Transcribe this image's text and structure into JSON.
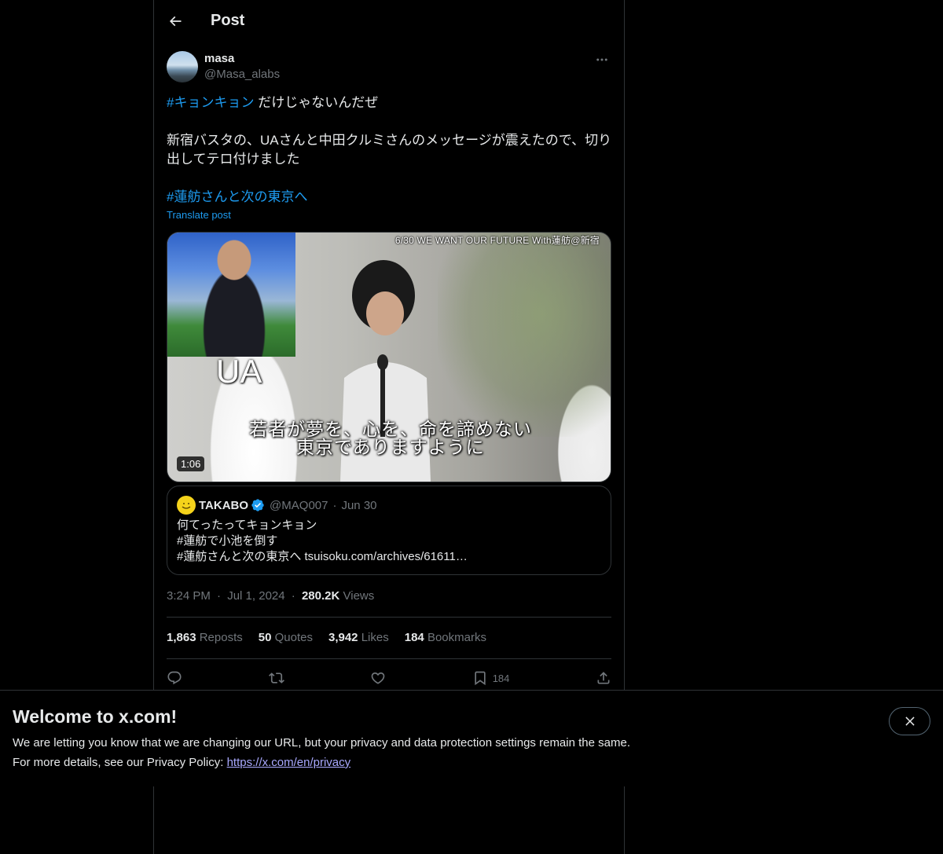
{
  "header": {
    "title": "Post"
  },
  "author": {
    "name": "masa",
    "handle": "@Masa_alabs"
  },
  "post": {
    "line1_hashtag": "#キョンキョン",
    "line1_rest": " だけじゃないんだぜ",
    "paragraph2": "新宿バスタの、UAさんと中田クルミさんのメッセージが震えたので、切り出してテロ付けました",
    "hashtag2": "#蓮舫さんと次の東京へ",
    "translate_label": "Translate post"
  },
  "media": {
    "top_caption": "6/30 WE WANT OUR FUTURE With蓮舫@新宿",
    "name_caption": "UA",
    "subtitle_line1": "若者が夢を、心を、命を諦めない",
    "subtitle_line2": "東京でありますように",
    "duration": "1:06"
  },
  "quote": {
    "name": "TAKABO",
    "handle": "@MAQ007",
    "dot": "·",
    "date": "Jun 30",
    "text": "何てったってキョンキョン\n#蓮舫で小池を倒す\n#蓮舫さんと次の東京へ tsuisoku.com/archives/61611…"
  },
  "meta": {
    "time": "3:24 PM",
    "dot1": "·",
    "date": "Jul 1, 2024",
    "dot2": "·",
    "views_count": "280.2K",
    "views_label": "Views"
  },
  "stats": {
    "reposts_count": "1,863",
    "reposts_label": "Reposts",
    "quotes_count": "50",
    "quotes_label": "Quotes",
    "likes_count": "3,942",
    "likes_label": "Likes",
    "bookmarks_count": "184",
    "bookmarks_label": "Bookmarks"
  },
  "actions": {
    "bookmark_count": "184"
  },
  "banner": {
    "title": "Welcome to x.com!",
    "line1": "We are letting you know that we are changing our URL, but your privacy and data protection settings remain the same.",
    "line2_prefix": "For more details, see our Privacy Policy: ",
    "link": "https://x.com/en/privacy"
  },
  "colors": {
    "accent": "#1d9bf0",
    "text": "#e7e9ea",
    "muted": "#71767b",
    "border": "#2f3336",
    "background": "#000000"
  },
  "icons": [
    "back-arrow-icon",
    "more-icon",
    "verified-badge-icon",
    "reply-icon",
    "repost-icon",
    "like-icon",
    "bookmark-icon",
    "share-icon",
    "close-icon"
  ]
}
